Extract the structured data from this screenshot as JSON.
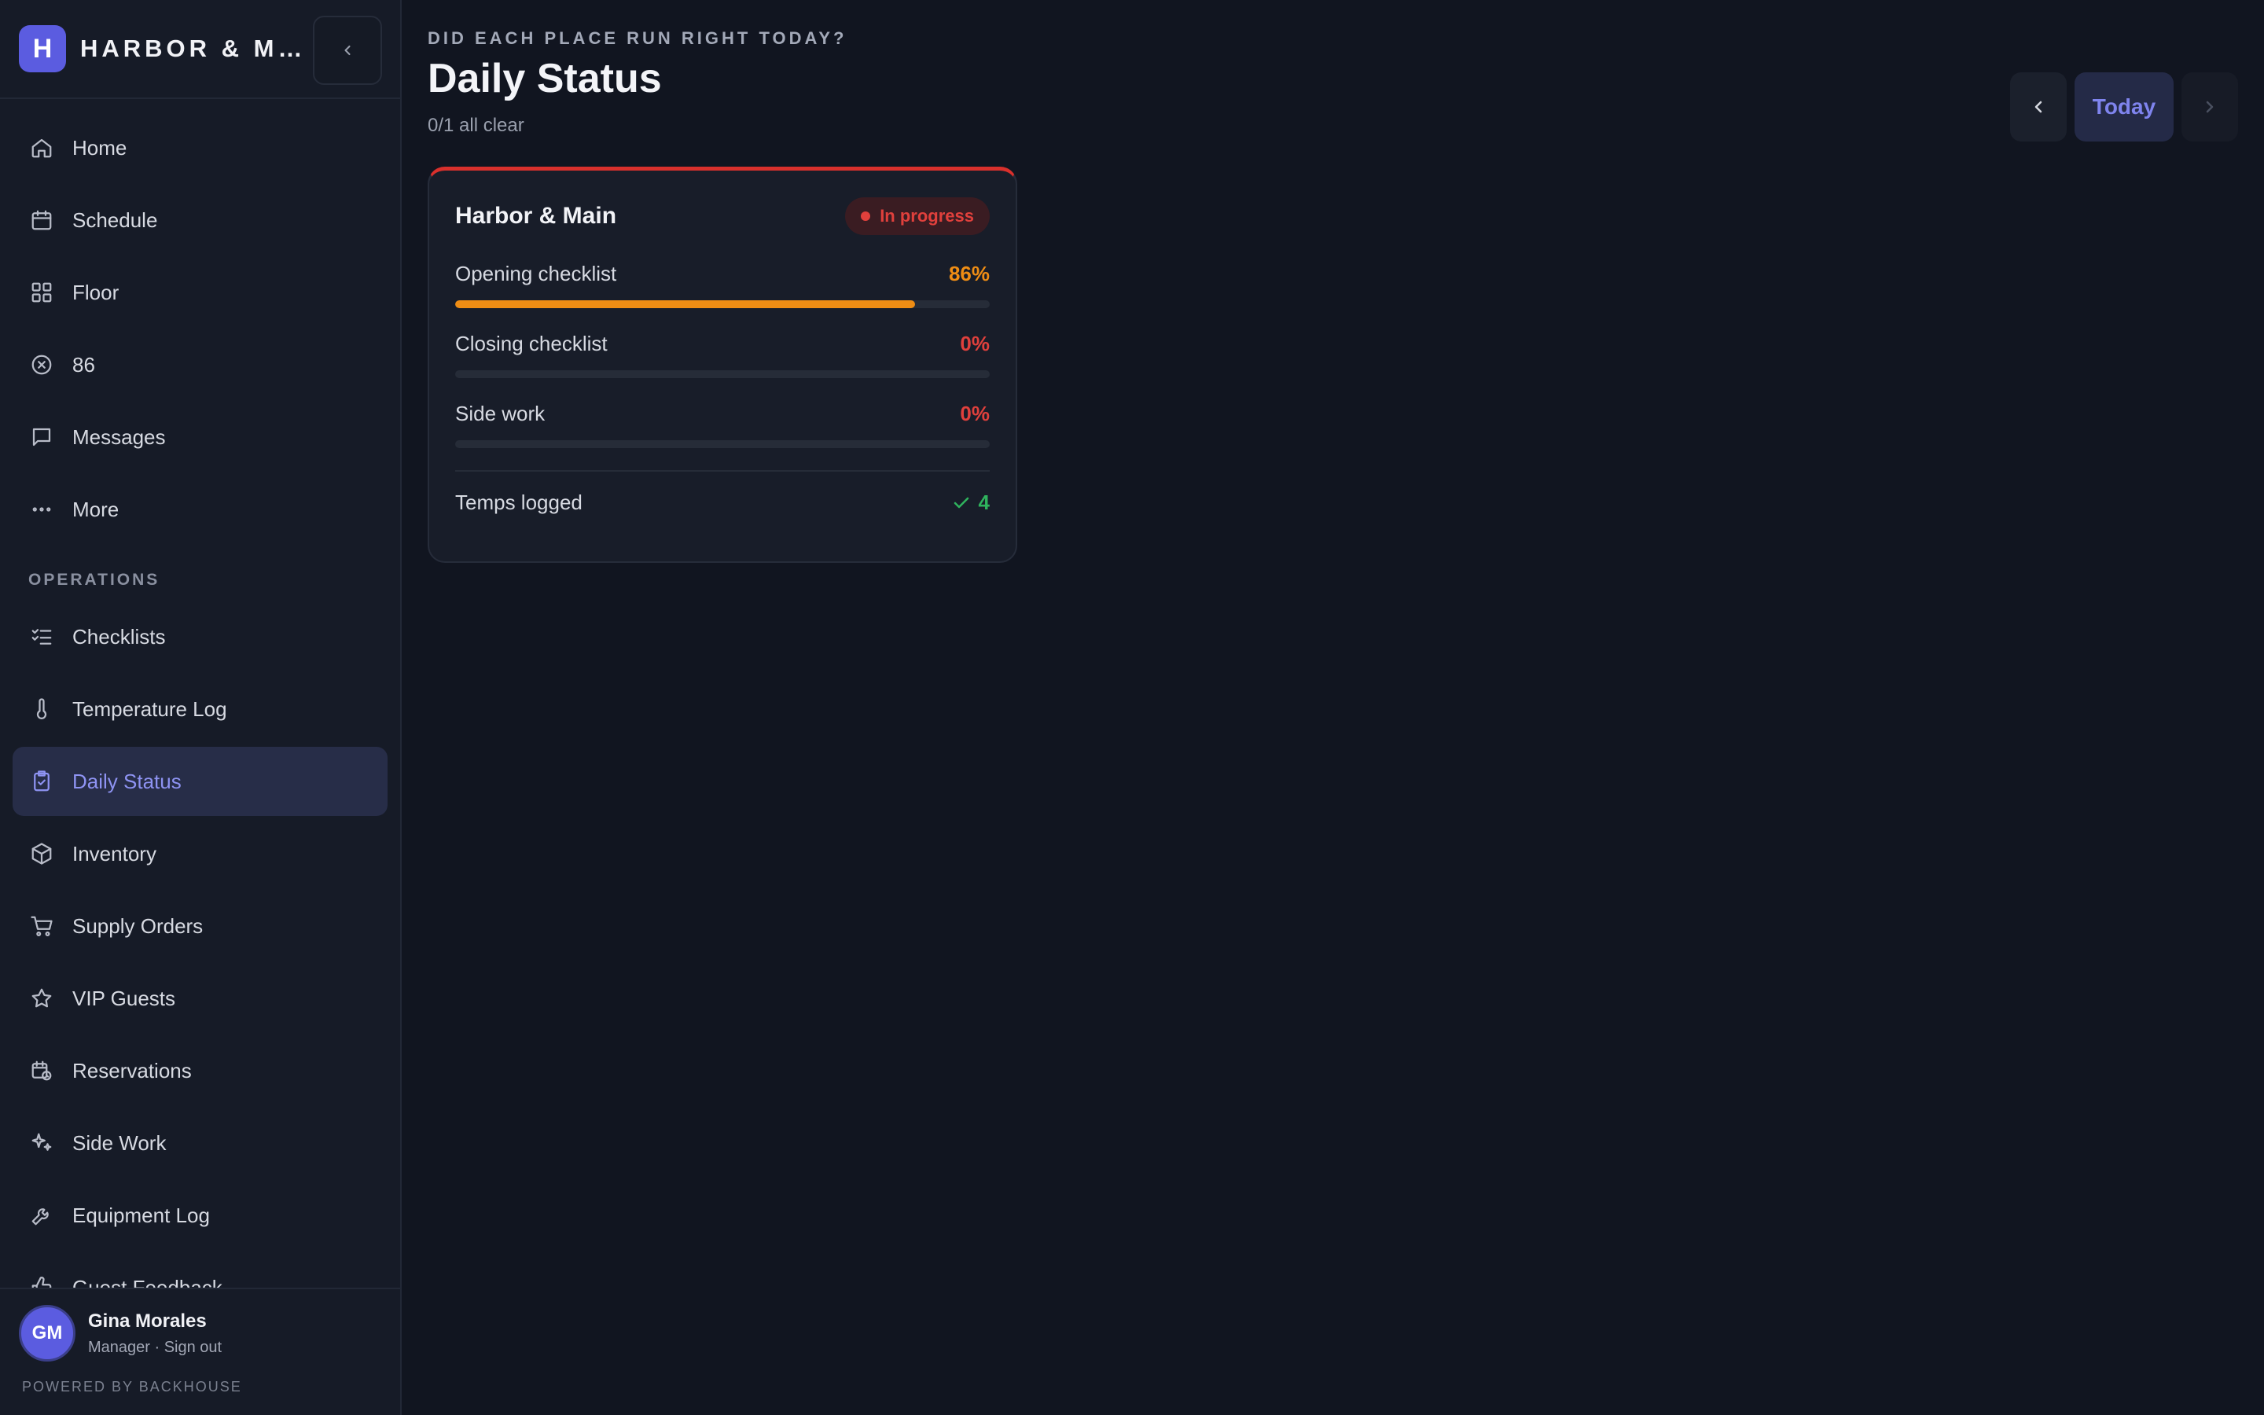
{
  "sidebar": {
    "logo_letter": "H",
    "brand": "HARBOR & MAIN",
    "nav_primary": [
      {
        "label": "Home",
        "icon": "home-icon"
      },
      {
        "label": "Schedule",
        "icon": "calendar-icon"
      },
      {
        "label": "Floor",
        "icon": "grid-icon"
      },
      {
        "label": "86",
        "icon": "x-circle-icon"
      },
      {
        "label": "Messages",
        "icon": "message-icon"
      },
      {
        "label": "More",
        "icon": "more-icon"
      }
    ],
    "section_label": "OPERATIONS",
    "nav_operations": [
      {
        "label": "Checklists",
        "icon": "checklist-icon"
      },
      {
        "label": "Temperature Log",
        "icon": "thermometer-icon"
      },
      {
        "label": "Daily Status",
        "icon": "clipboard-check-icon",
        "active": true
      },
      {
        "label": "Inventory",
        "icon": "box-icon"
      },
      {
        "label": "Supply Orders",
        "icon": "cart-icon"
      },
      {
        "label": "VIP Guests",
        "icon": "star-icon"
      },
      {
        "label": "Reservations",
        "icon": "calendar-clock-icon"
      },
      {
        "label": "Side Work",
        "icon": "sparkles-icon"
      },
      {
        "label": "Equipment Log",
        "icon": "wrench-icon"
      },
      {
        "label": "Guest Feedback",
        "icon": "thumbs-up-icon"
      }
    ],
    "user": {
      "initials": "GM",
      "name": "Gina Morales",
      "role": "Manager · Sign out"
    },
    "powered_by": "POWERED BY BACKHOUSE"
  },
  "main": {
    "eyebrow": "DID EACH PLACE RUN RIGHT TODAY?",
    "title": "Daily Status",
    "subtitle": "0/1 all clear",
    "date_nav": {
      "today_label": "Today"
    },
    "card": {
      "title": "Harbor & Main",
      "badge": "In progress",
      "rows": [
        {
          "label": "Opening checklist",
          "value": "86%",
          "fraction": 0.86,
          "tone": "orange"
        },
        {
          "label": "Closing checklist",
          "value": "0%",
          "fraction": 0,
          "tone": "red"
        },
        {
          "label": "Side work",
          "value": "0%",
          "fraction": 0,
          "tone": "red"
        }
      ],
      "temps_label": "Temps logged",
      "temps_value": "4"
    }
  },
  "colors": {
    "accent": "#5b5ce0",
    "danger": "#e0403c",
    "warning": "#ef8d14",
    "success": "#2fb35d"
  }
}
